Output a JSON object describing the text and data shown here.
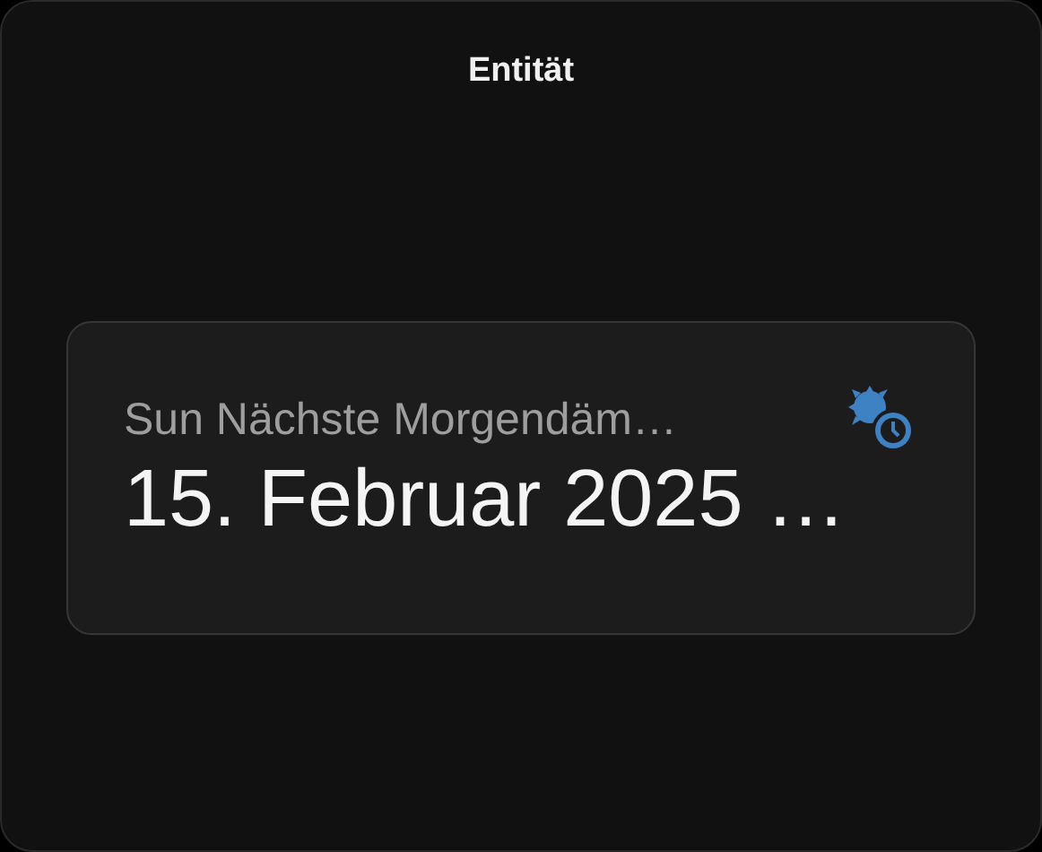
{
  "dialog": {
    "title": "Entität"
  },
  "card": {
    "name": "Sun Nächste Morgendäm…",
    "value": "15. Februar 2025 …"
  }
}
